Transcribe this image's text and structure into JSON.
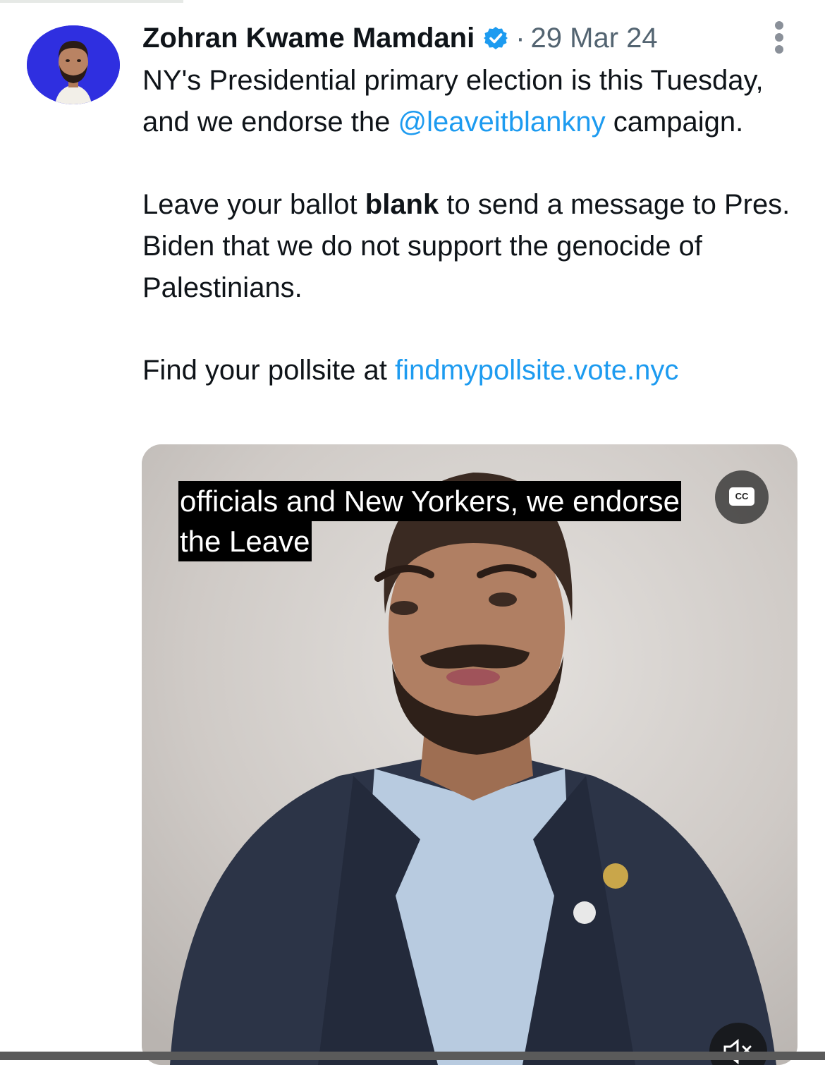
{
  "tweet": {
    "author_name": "Zohran Kwame Mamdani",
    "separator": "·",
    "timestamp": "29 Mar 24",
    "text": {
      "line1_prefix": "NY's Presidential primary election is this Tuesday, and we endorse the ",
      "mention": "@leaveitblankny",
      "line1_suffix": " campaign.",
      "p2_prefix": "Leave your ballot ",
      "p2_bold": "blank",
      "p2_suffix": " to send a message to Pres. Biden that we do not support the genocide of Palestinians.",
      "p3_prefix": "Find your pollsite at ",
      "p3_link": "findmypollsite.vote.nyc"
    },
    "video": {
      "caption_line1": "officials and New Yorkers, we endorse",
      "caption_line2": "the Leave",
      "cc_label": "CC"
    }
  },
  "colors": {
    "link": "#1d9bf0",
    "avatar_bg": "#2f2fe0",
    "verified": "#1d9bf0"
  },
  "icons": {
    "verified": "verified-badge-icon",
    "more": "more-options-icon",
    "cc": "closed-captions-icon",
    "mute": "mute-icon"
  }
}
